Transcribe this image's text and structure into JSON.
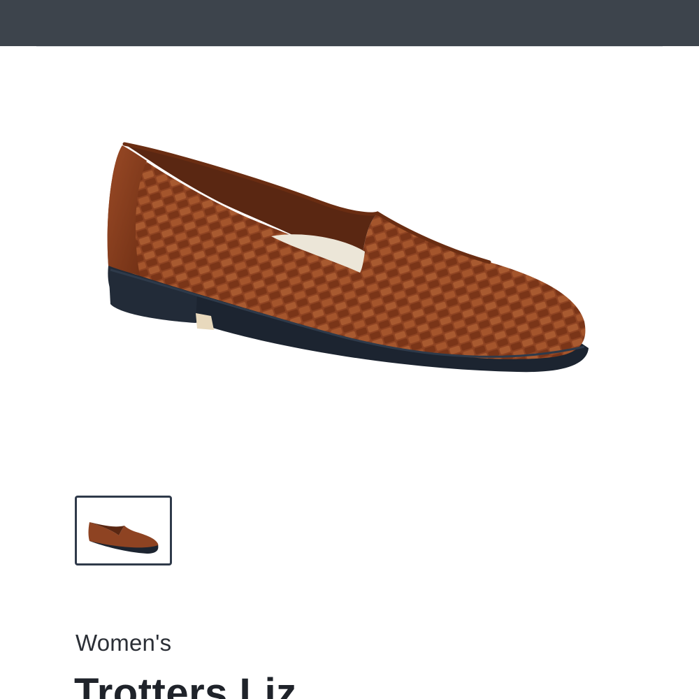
{
  "header": {
    "bar_color": "#3d444c"
  },
  "gallery": {
    "main_image": {
      "icon": "loafer-product-photo",
      "color": "#8a3e1f"
    },
    "thumbnails": [
      {
        "icon": "loafer-thumbnail",
        "selected": true,
        "border_color": "#2f3a4a"
      }
    ]
  },
  "product": {
    "category": "Women's",
    "title": "Trotters Liz"
  }
}
